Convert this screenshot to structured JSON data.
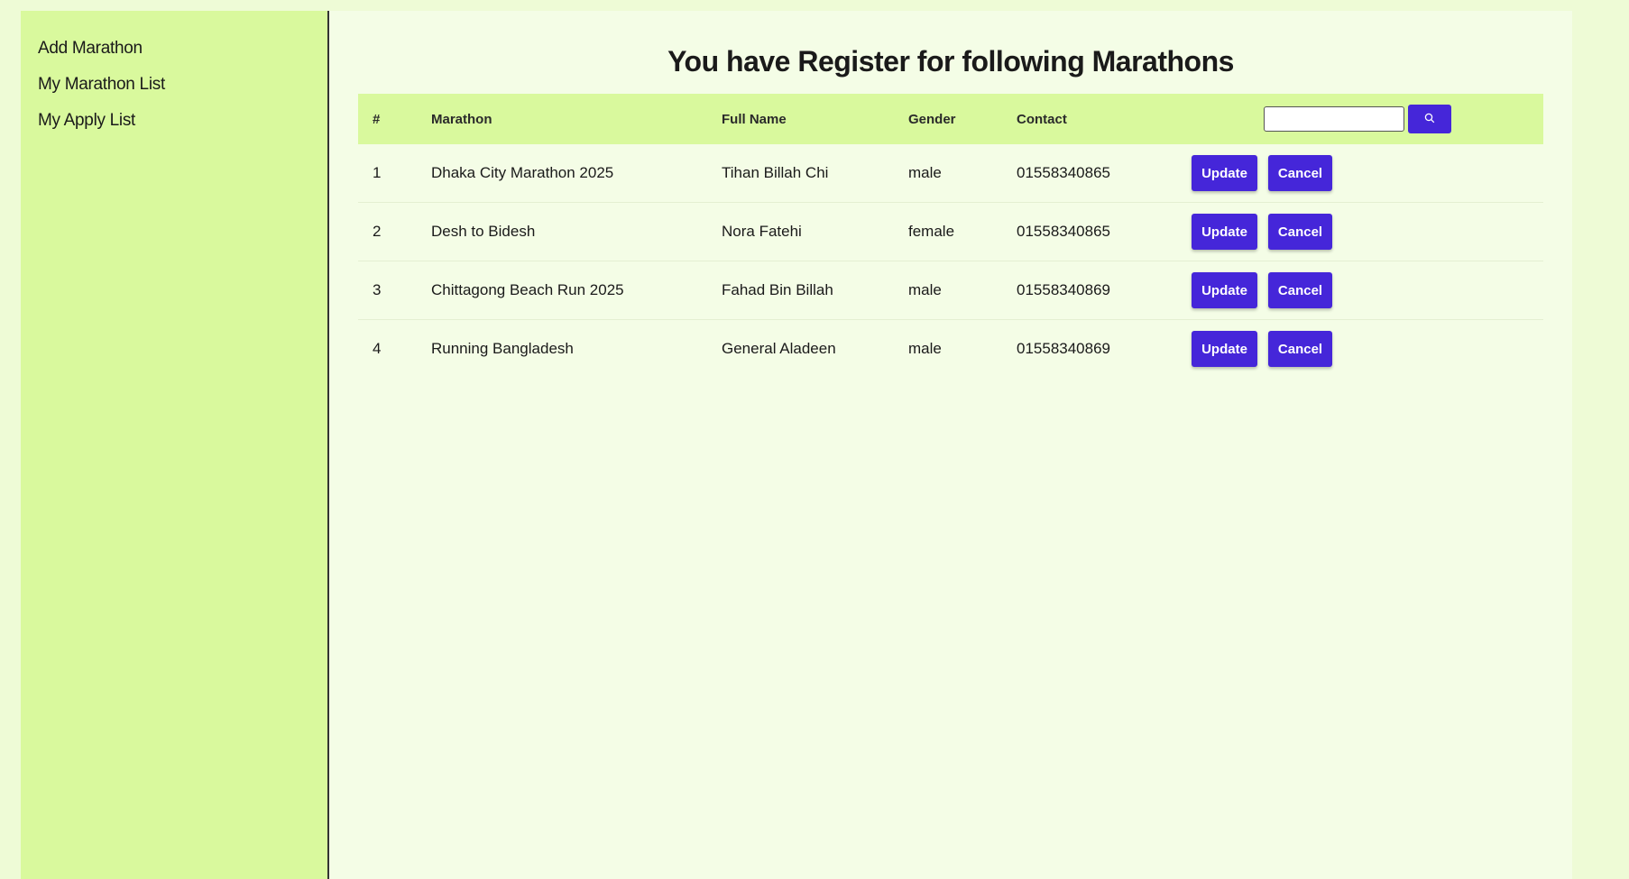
{
  "sidebar": {
    "items": [
      {
        "label": "Add Marathon"
      },
      {
        "label": "My Marathon List"
      },
      {
        "label": "My Apply List"
      }
    ]
  },
  "main": {
    "title": "You have Register for following Marathons",
    "columns": {
      "num": "#",
      "marathon": "Marathon",
      "full_name": "Full Name",
      "gender": "Gender",
      "contact": "Contact"
    },
    "search": {
      "placeholder": "",
      "icon": "search-icon"
    },
    "rows": [
      {
        "num": "1",
        "marathon": "Dhaka City Marathon 2025",
        "full_name": "Tihan Billah Chi",
        "gender": "male",
        "contact": "01558340865"
      },
      {
        "num": "2",
        "marathon": "Desh to Bidesh",
        "full_name": "Nora Fatehi",
        "gender": "female",
        "contact": "01558340865"
      },
      {
        "num": "3",
        "marathon": "Chittagong Beach Run 2025",
        "full_name": "Fahad Bin Billah",
        "gender": "male",
        "contact": "01558340869"
      },
      {
        "num": "4",
        "marathon": "Running Bangladesh",
        "full_name": "General Aladeen",
        "gender": "male",
        "contact": "01558340869"
      }
    ],
    "actions": {
      "update_label": "Update",
      "cancel_label": "Cancel"
    }
  },
  "colors": {
    "page_bg": "#eefbd6",
    "sidebar_bg": "#d9f99d",
    "main_bg": "#f4fde6",
    "header_bg": "#d9f99d",
    "button": "#4526d9"
  }
}
